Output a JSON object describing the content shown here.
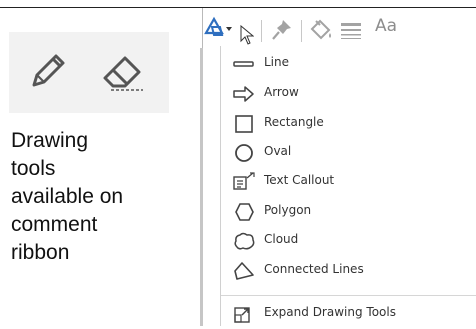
{
  "caption": "Drawing\ntools\navailable on\ncomment\nribbon",
  "colors": {
    "icon": "#333333",
    "toolbar_icon": "#a3a3a3",
    "accent": "#2f6fbf",
    "tile_bg": "#f2f2f2"
  },
  "tiles": [
    {
      "icon": "pencil-icon"
    },
    {
      "icon": "eraser-icon"
    }
  ],
  "toolbar": {
    "items": [
      {
        "icon": "drawing-tools-icon"
      },
      {
        "icon": "cursor-icon"
      },
      {
        "icon": "pin-icon"
      },
      {
        "icon": "fill-bucket-icon"
      },
      {
        "icon": "line-weight-icon"
      }
    ],
    "font_label": "Aa"
  },
  "menu": {
    "items": [
      {
        "label": "Line",
        "icon": "line-icon"
      },
      {
        "label": "Arrow",
        "icon": "arrow-icon"
      },
      {
        "label": "Rectangle",
        "icon": "rectangle-icon"
      },
      {
        "label": "Oval",
        "icon": "oval-icon"
      },
      {
        "label": "Text Callout",
        "icon": "text-callout-icon"
      },
      {
        "label": "Polygon",
        "icon": "polygon-icon"
      },
      {
        "label": "Cloud",
        "icon": "cloud-icon"
      },
      {
        "label": "Connected Lines",
        "icon": "connected-lines-icon"
      }
    ],
    "footer": {
      "label": "Expand Drawing Tools",
      "icon": "expand-icon"
    }
  }
}
